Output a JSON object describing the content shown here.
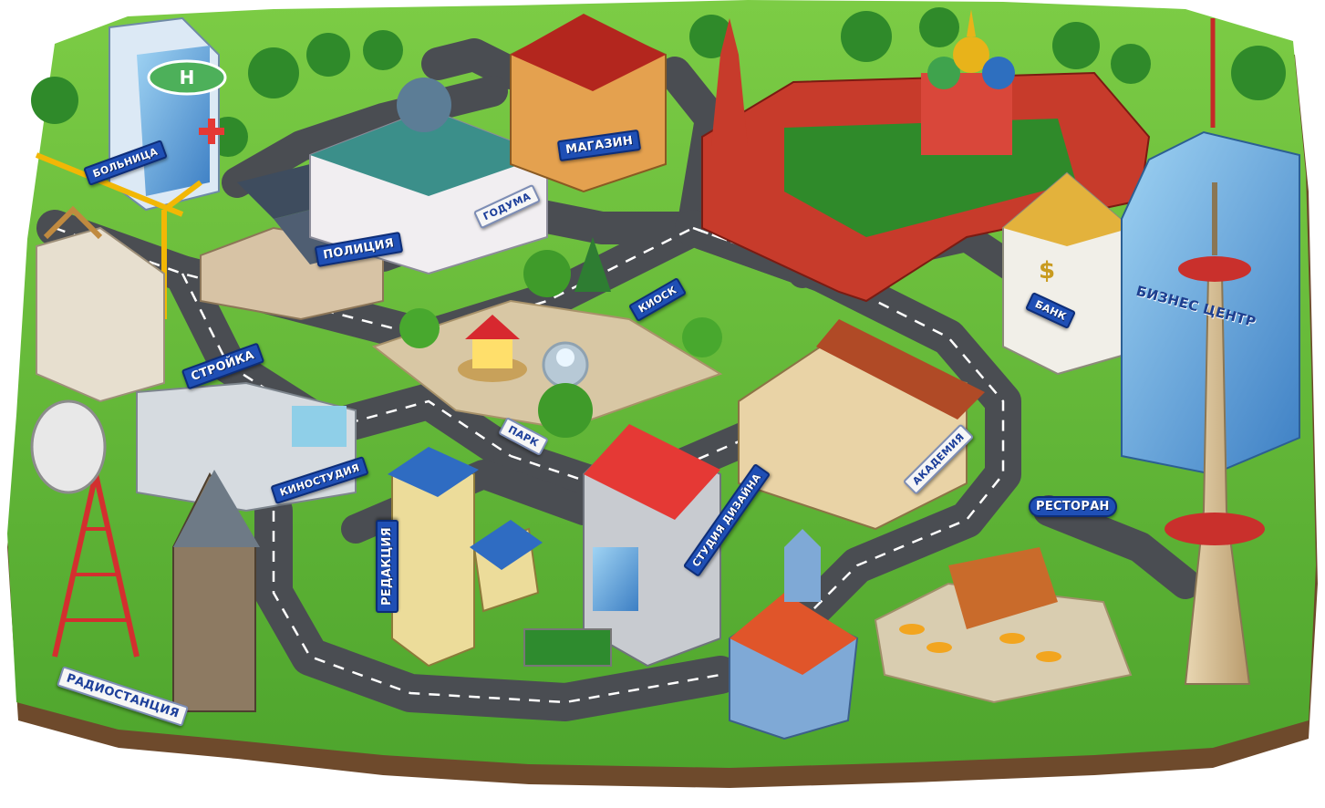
{
  "labels": {
    "hospital": "БОЛЬНИЦА",
    "shop": "МАГАЗИН",
    "police": "ПОЛИЦИЯ",
    "city_hall": "ГОДУМА",
    "construction": "СТРОЙКА",
    "kiosk": "КИОСК",
    "park": "ПАРК",
    "bank": "БАНК",
    "business_center": "БИЗНЕС ЦЕНТР",
    "academy": "АКАДЕМИЯ",
    "film_studio": "КИНОСТУДИЯ",
    "editorial": "РЕДАКЦИЯ",
    "design_studio": "СТУДИЯ ДИЗАЙНА",
    "restaurant": "РЕСТОРАН",
    "radio_station": "РАДИОСТАНЦИЯ"
  },
  "icons": {
    "helipad": "helipad-icon",
    "hospital_cross": "red-cross-icon",
    "bank_sign": "dollar-icon"
  },
  "colors": {
    "grass": "#5fb83a",
    "grass_dark": "#3f8f27",
    "earth": "#6e4a2c",
    "road": "#4a4d52",
    "sign_blue": "#1f4fb5",
    "kremlin_red": "#b3261e",
    "roof_red": "#c9302c"
  }
}
